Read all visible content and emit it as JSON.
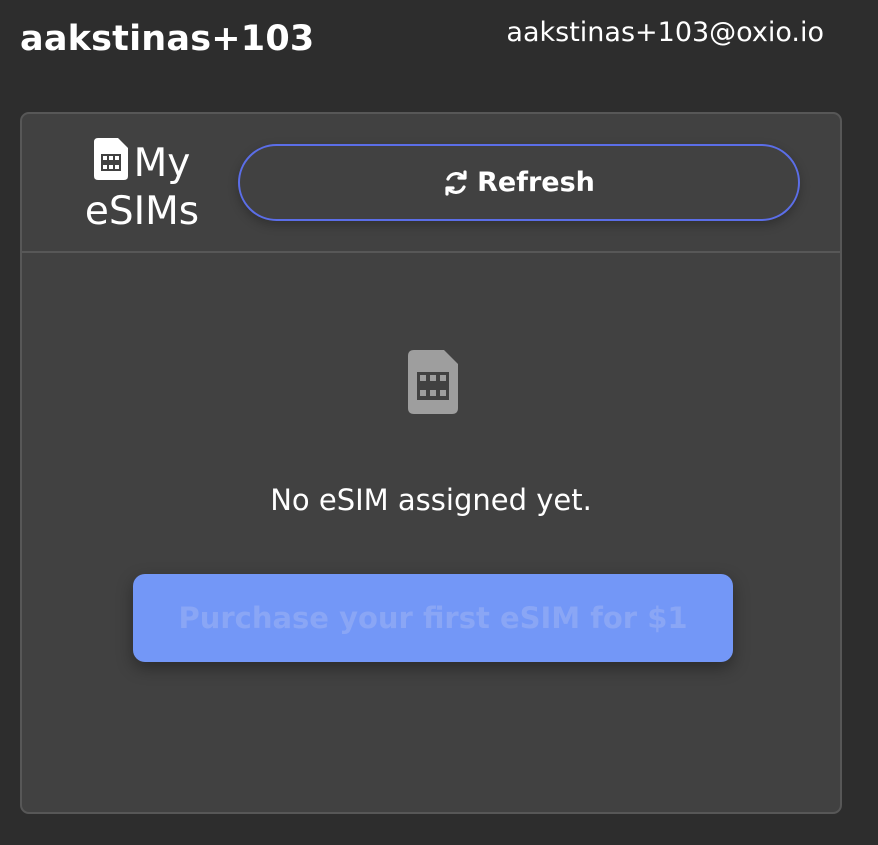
{
  "header": {
    "username": "aakstinas+103",
    "email": "aakstinas+103@oxio.io"
  },
  "card": {
    "title": "My eSIMs",
    "title_icon": "sim-card-icon",
    "refresh_label": "Refresh",
    "refresh_icon": "refresh-icon",
    "empty_icon": "sim-card-icon",
    "empty_message": "No eSIM assigned yet.",
    "purchase_label": "Purchase your first eSIM for $1"
  },
  "colors": {
    "background": "#2d2d2d",
    "card_background": "#414141",
    "accent_border": "#5b6ee8",
    "purchase_button": "#7397f7",
    "purchase_text": "#8aa6f5",
    "empty_icon": "#9e9e9e"
  }
}
